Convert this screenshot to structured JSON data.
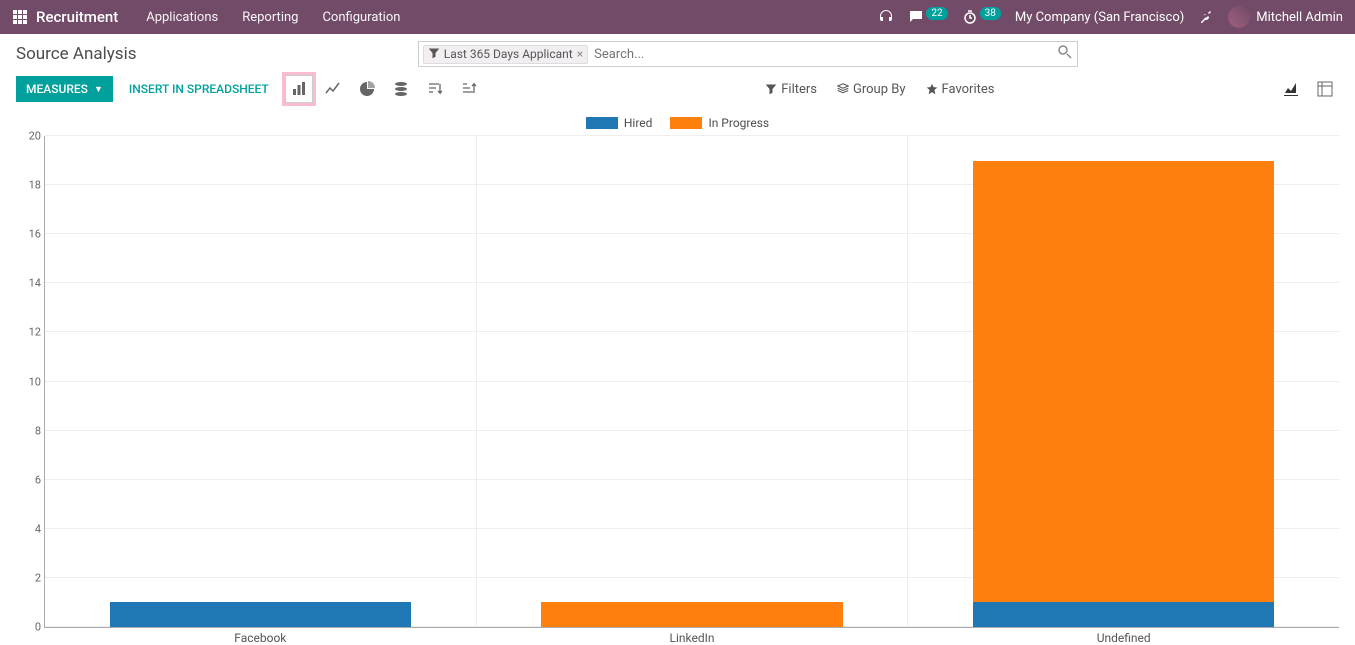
{
  "topbar": {
    "brand": "Recruitment",
    "nav": [
      "Applications",
      "Reporting",
      "Configuration"
    ],
    "chat_badge": "22",
    "timer_badge": "38",
    "company": "My Company (San Francisco)",
    "user": "Mitchell Admin"
  },
  "page": {
    "title": "Source Analysis",
    "filter_chip": "Last 365 Days Applicant",
    "search_placeholder": "Search..."
  },
  "toolbar": {
    "measures": "MEASURES",
    "insert": "INSERT IN SPREADSHEET",
    "filters": "Filters",
    "groupby": "Group By",
    "favorites": "Favorites"
  },
  "colors": {
    "hired": "#1f77b4",
    "in_progress": "#ff7f0e"
  },
  "chart_data": {
    "type": "bar",
    "stacked": true,
    "title": "",
    "xlabel": "",
    "ylabel": "",
    "ylim": [
      0,
      20
    ],
    "yticks": [
      0,
      2,
      4,
      6,
      8,
      10,
      12,
      14,
      16,
      18,
      20
    ],
    "categories": [
      "Facebook",
      "LinkedIn",
      "Undefined"
    ],
    "series": [
      {
        "name": "Hired",
        "values": [
          1,
          0,
          1
        ]
      },
      {
        "name": "In Progress",
        "values": [
          0,
          1,
          18
        ]
      }
    ],
    "legend_position": "top"
  }
}
